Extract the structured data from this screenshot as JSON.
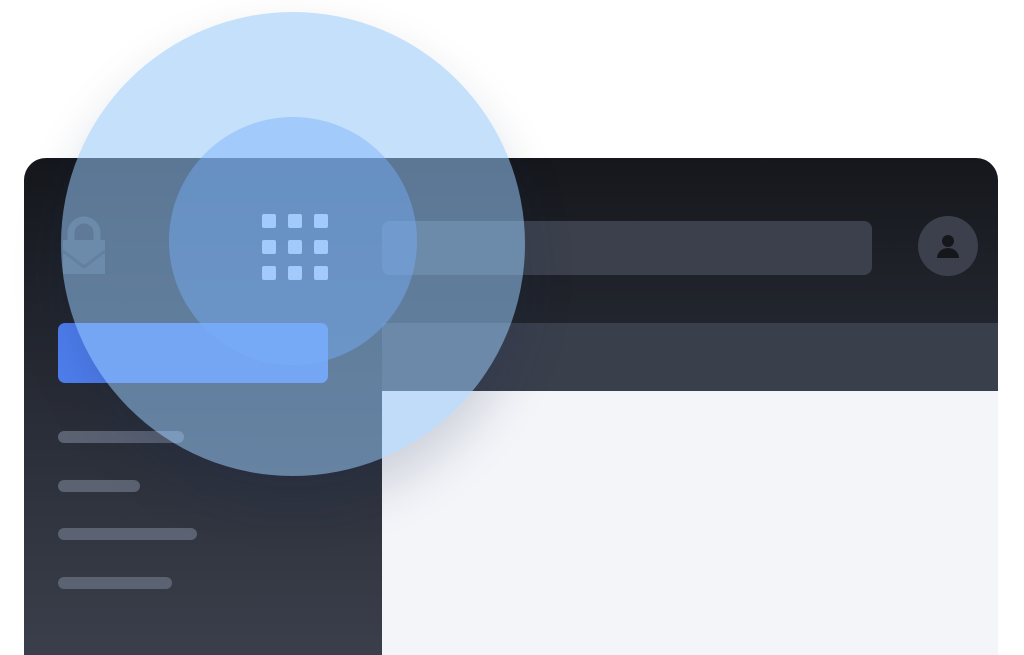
{
  "app": {
    "logo_icon": "envelope-lock-icon",
    "apps_icon": "apps-grid-icon",
    "avatar_icon": "user-icon",
    "search": {
      "value": "",
      "placeholder": ""
    }
  },
  "sidebar": {
    "compose_label": "",
    "items": [
      {
        "label": ""
      },
      {
        "label": ""
      },
      {
        "label": ""
      },
      {
        "label": ""
      }
    ]
  },
  "colors": {
    "accent": "#4f7ff0",
    "chrome_dark": "#1d2027",
    "panel": "#3b404c",
    "content_bg": "#f4f5f9",
    "highlight": "#96c6f8"
  }
}
